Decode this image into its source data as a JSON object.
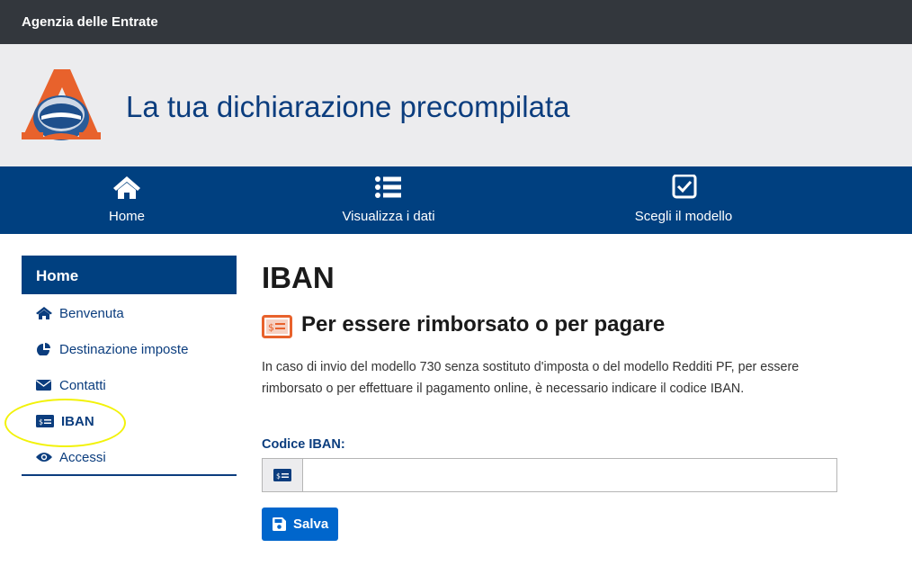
{
  "topbar": {
    "title": "Agenzia delle Entrate"
  },
  "header": {
    "site_title": "La tua dichiarazione precompilata",
    "logo_icon": "agenzia-entrate-logo"
  },
  "nav": {
    "items": [
      {
        "label": "Home",
        "icon": "home-icon"
      },
      {
        "label": "Visualizza i dati",
        "icon": "list-icon"
      },
      {
        "label": "Scegli il modello",
        "icon": "checkbox-icon"
      }
    ]
  },
  "sidebar": {
    "heading": "Home",
    "items": [
      {
        "label": "Benvenuta",
        "icon": "home-icon"
      },
      {
        "label": "Destinazione imposte",
        "icon": "pie-chart-icon"
      },
      {
        "label": "Contatti",
        "icon": "envelope-icon"
      },
      {
        "label": "IBAN",
        "icon": "money-card-icon",
        "active": true
      },
      {
        "label": "Accessi",
        "icon": "eye-icon"
      }
    ]
  },
  "main": {
    "title": "IBAN",
    "subtitle": "Per essere rimborsato o per pagare",
    "paragraph": "In caso di invio del modello 730 senza sostituto d'imposta o del modello Redditi PF, per essere rimborsato o per effettuare il pagamento online, è necessario indicare il codice IBAN.",
    "field_label": "Codice IBAN:",
    "field_value": "",
    "save_label": "Salva"
  },
  "colors": {
    "topbar": "#33373d",
    "header_bg": "#ececee",
    "nav_bg": "#004080",
    "title_blue": "#0b3d7e",
    "button": "#0066cc",
    "accent_orange": "#e8622c",
    "highlight": "#f2f20a"
  }
}
